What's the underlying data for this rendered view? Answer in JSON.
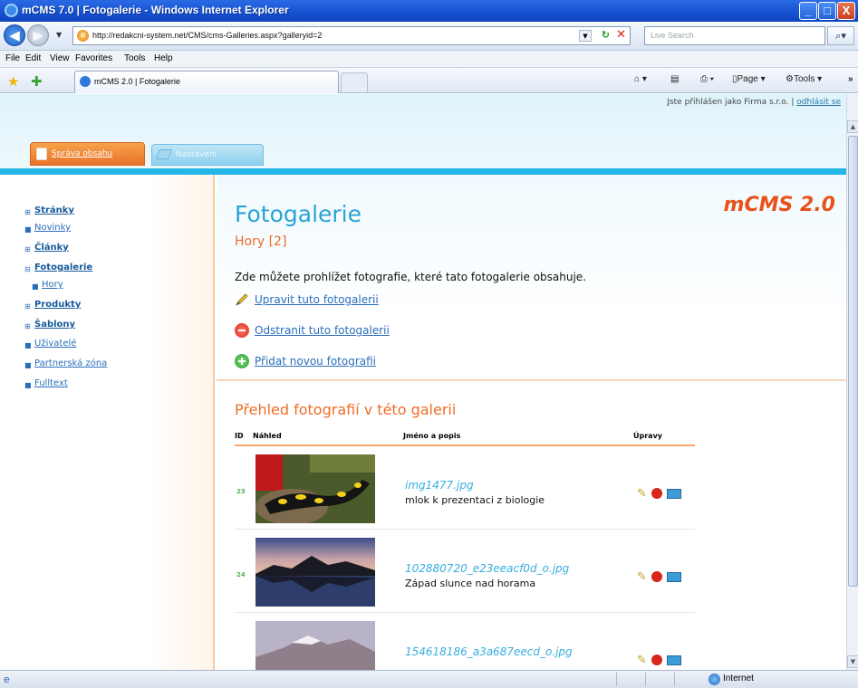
{
  "window": {
    "title": "mCMS 7.0 | Fotogalerie - Windows Internet Explorer",
    "minimize": "_",
    "maximize": "□",
    "close": "X"
  },
  "browser": {
    "url": "http://redakcni-system.net/CMS/cms-Galleries.aspx?galleryid=2",
    "search_placeholder": "Live Search",
    "menu": [
      "File",
      "Edit",
      "View",
      "Favorites",
      "Tools",
      "Help"
    ],
    "tab_label": "mCMS 2.0 | Fotogalerie",
    "page_label": "Page",
    "tools_label": "Tools",
    "status_zone": "Internet"
  },
  "header": {
    "logged_in_text": "Jste přihlášen jako Firma s.r.o. | ",
    "logout_label": "odhlásit se",
    "tab_content": "Správa obsahu",
    "tab_admin": "Nastavení"
  },
  "sidebar": {
    "items": [
      {
        "label": "Stránky",
        "bold": true,
        "expand": "⊞"
      },
      {
        "label": "Novinky",
        "bold": false,
        "expand": "■"
      },
      {
        "label": "Články",
        "bold": true,
        "expand": "⊞"
      },
      {
        "label": "Fotogalerie",
        "bold": true,
        "expand": "⊟"
      },
      {
        "label": "Hory",
        "bold": false,
        "expand": "■"
      },
      {
        "label": "Produkty",
        "bold": true,
        "expand": "⊞"
      },
      {
        "label": "Šablony",
        "bold": true,
        "expand": "⊞"
      },
      {
        "label": "Uživatelé",
        "bold": false,
        "expand": "■"
      },
      {
        "label": "Partnerská zóna",
        "bold": false,
        "expand": "■"
      },
      {
        "label": "Fulltext",
        "bold": false,
        "expand": "■"
      }
    ]
  },
  "main": {
    "logo": "mCMS 2.0",
    "title": "Fotogalerie",
    "subtitle": "Hory [2]",
    "description": "Zde můžete prohlížet fotografie, které tato fotogalerie obsahuje.",
    "actions": {
      "edit": "Upravit tuto fotogalerii",
      "delete": "Odstranit tuto fotogalerii",
      "add": "Přidat novou fotografii"
    },
    "section_title": "Přehled fotografií v této galerii",
    "table": {
      "headers": {
        "id": "ID",
        "preview": "Náhled",
        "name": "Jméno a popis",
        "edits": "Úpravy"
      },
      "rows": [
        {
          "id": "23",
          "filename": "img1477.jpg",
          "description": "mlok k prezentaci z biologie"
        },
        {
          "id": "24",
          "filename": "102880720_e23eeacf0d_o.jpg",
          "description": "Západ slunce nad horama"
        },
        {
          "id": "",
          "filename": "154618186_a3a687eecd_o.jpg",
          "description": ""
        }
      ]
    }
  },
  "colors": {
    "accent_blue": "#2ba3d5",
    "accent_orange": "#ef6c27",
    "link": "#2a6ebb"
  }
}
